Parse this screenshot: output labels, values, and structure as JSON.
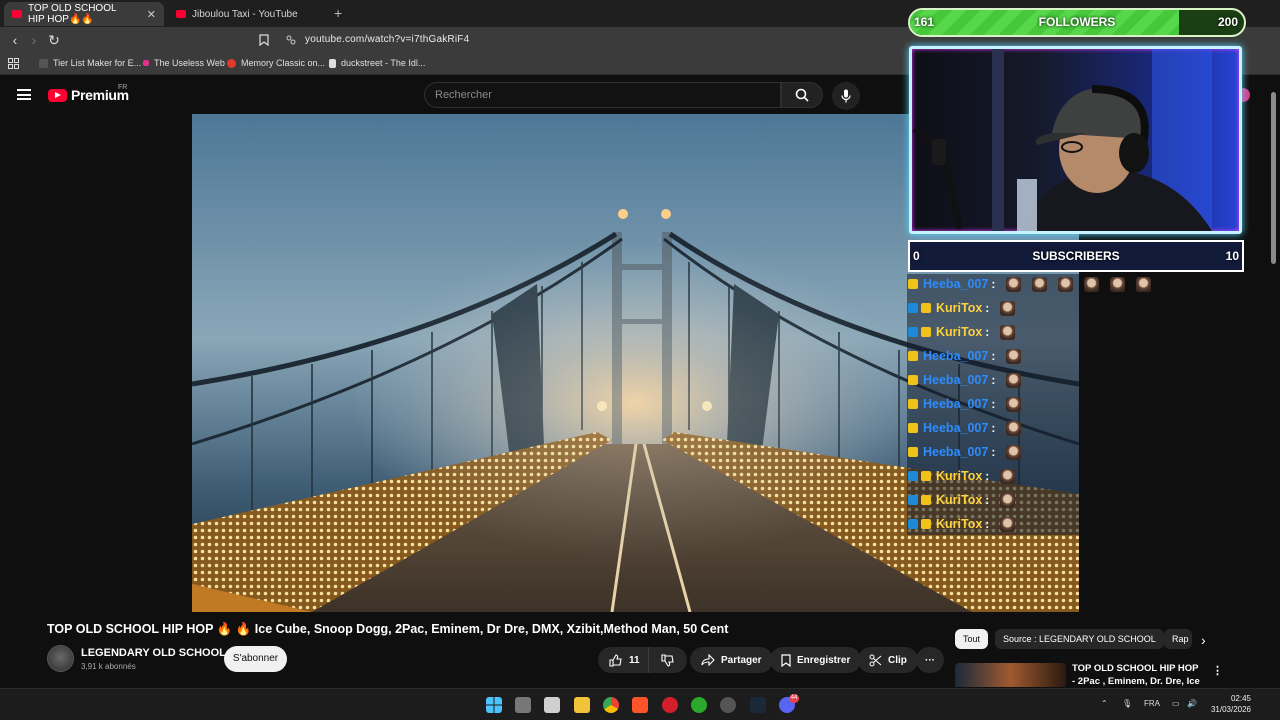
{
  "browser": {
    "tabs": [
      {
        "label": "TOP OLD SCHOOL HIP HOP🔥🔥",
        "active": true
      },
      {
        "label": "Jiboulou Taxi - YouTube",
        "active": false
      }
    ],
    "close_glyph": "✕",
    "newtab_glyph": "+",
    "url": "youtube.com/watch?v=i7thGakRiF4",
    "bookmarks": [
      "Tier List Maker for E...",
      "The Useless Web",
      "Memory Classic on...",
      "duckstreet - The Idl..."
    ]
  },
  "youtube": {
    "logo_text": "Premium",
    "region": "FR",
    "search_placeholder": "Rechercher",
    "video_title": "TOP OLD SCHOOL HIP HOP 🔥 🔥 Ice Cube, Snoop Dogg, 2Pac, Eminem, Dr Dre, DMX, Xzibit,Method Man, 50 Cent",
    "channel_name": "LEGENDARY OLD SCHOOL",
    "subscriber_count": "3,91 k abonnés",
    "subscribe_label": "S'abonner",
    "like_count": "11",
    "share_label": "Partager",
    "save_label": "Enregistrer",
    "clip_label": "Clip",
    "more_glyph": "···",
    "chips": [
      "Tout",
      "Source : LEGENDARY OLD SCHOOL",
      "Rap"
    ],
    "recommended": [
      {
        "title": "TOP OLD SCHOOL HIP HOP - 2Pac , Eminem, Dr. Dre, Ice ..."
      }
    ]
  },
  "overlay": {
    "followers": {
      "label": "FOLLOWERS",
      "current": "161",
      "goal": "200",
      "progress": 0.805
    },
    "subscribers": {
      "label": "SUBSCRIBERS",
      "current": "0",
      "goal": "10",
      "progress": 0
    },
    "chat": [
      {
        "user": "Heeba_007",
        "color": "blue",
        "badges": [
          "crown"
        ],
        "emotes": 6
      },
      {
        "user": "KuriTox",
        "color": "gold",
        "badges": [
          "blue",
          "crown"
        ],
        "emotes": 1
      },
      {
        "user": "KuriTox",
        "color": "gold",
        "badges": [
          "blue",
          "crown"
        ],
        "emotes": 1
      },
      {
        "user": "Heeba_007",
        "color": "blue",
        "badges": [
          "crown"
        ],
        "emotes": 1
      },
      {
        "user": "Heeba_007",
        "color": "blue",
        "badges": [
          "crown"
        ],
        "emotes": 1
      },
      {
        "user": "Heeba_007",
        "color": "blue",
        "badges": [
          "crown"
        ],
        "emotes": 1
      },
      {
        "user": "Heeba_007",
        "color": "blue",
        "badges": [
          "crown"
        ],
        "emotes": 1
      },
      {
        "user": "Heeba_007",
        "color": "blue",
        "badges": [
          "crown"
        ],
        "emotes": 1
      },
      {
        "user": "KuriTox",
        "color": "gold",
        "badges": [
          "blue",
          "crown"
        ],
        "emotes": 1
      },
      {
        "user": "KuriTox",
        "color": "gold",
        "badges": [
          "blue",
          "crown"
        ],
        "emotes": 1
      },
      {
        "user": "KuriTox",
        "color": "gold",
        "badges": [
          "blue",
          "crown"
        ],
        "emotes": 1
      }
    ]
  },
  "taskbar": {
    "language": "FRA",
    "time": "02:45",
    "date": "31/03/2026",
    "discord_badge": "44"
  },
  "colors": {
    "youtube_red": "#ff0033",
    "followers_green": "#46c83a",
    "chat_blue": "#2d8cff",
    "chat_gold": "#ffd23a"
  }
}
